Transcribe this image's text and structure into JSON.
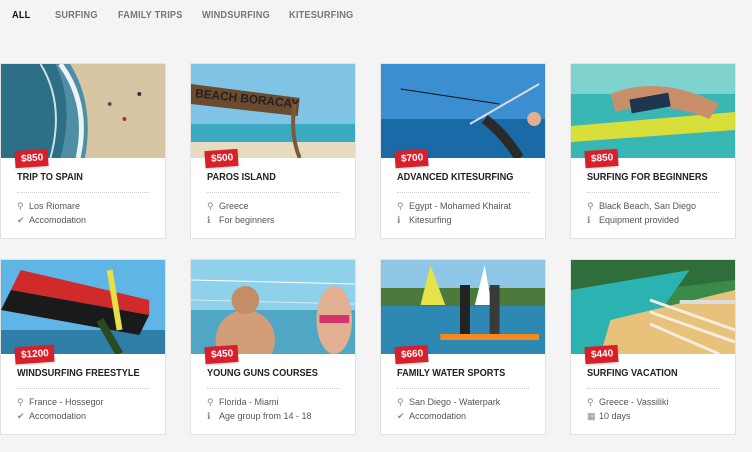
{
  "tabs": [
    {
      "label": "ALL",
      "active": true
    },
    {
      "label": "SURFING",
      "active": false
    },
    {
      "label": "FAMILY TRIPS",
      "active": false
    },
    {
      "label": "WINDSURFING",
      "active": false
    },
    {
      "label": "KITESURFING",
      "active": false
    }
  ],
  "cards": [
    {
      "price": "$850",
      "title": "TRIP TO SPAIN",
      "line1": "Los Riomare",
      "line1_icon": "map-marker-icon",
      "line2": "Accomodation",
      "line2_icon": "check-icon"
    },
    {
      "price": "$500",
      "title": "PAROS ISLAND",
      "line1": "Greece",
      "line1_icon": "map-marker-icon",
      "line2": "For beginners",
      "line2_icon": "info-icon"
    },
    {
      "price": "$700",
      "title": "ADVANCED KITESURFING",
      "line1": "Egypt - Mohamed Khairat",
      "line1_icon": "map-marker-icon",
      "line2": "Kitesurfing",
      "line2_icon": "info-icon"
    },
    {
      "price": "$850",
      "title": "SURFING FOR BEGINNERS",
      "line1": "Black Beach, San Diego",
      "line1_icon": "map-marker-icon",
      "line2": "Equipment provided",
      "line2_icon": "info-icon"
    },
    {
      "price": "$1200",
      "title": "WINDSURFING FREESTYLE",
      "line1": "France - Hossegor",
      "line1_icon": "map-marker-icon",
      "line2": "Accomodation",
      "line2_icon": "check-icon"
    },
    {
      "price": "$450",
      "title": "YOUNG GUNS COURSES",
      "line1": "Florida - Miami",
      "line1_icon": "map-marker-icon",
      "line2": "Age group from 14 - 18",
      "line2_icon": "info-icon"
    },
    {
      "price": "$660",
      "title": "FAMILY WATER SPORTS",
      "line1": "San Diego - Waterpark",
      "line1_icon": "map-marker-icon",
      "line2": "Accomodation",
      "line2_icon": "check-icon"
    },
    {
      "price": "$440",
      "title": "SURFING VACATION",
      "line1": "Greece - Vassiliki",
      "line1_icon": "map-marker-icon",
      "line2": "10 days",
      "line2_icon": "calendar-icon"
    }
  ],
  "photo_texts": {
    "beach_sign": "BEACH BORACAY"
  },
  "colors": {
    "accent": "#d91f2a",
    "background": "#f4f4f4",
    "card": "#ffffff"
  }
}
